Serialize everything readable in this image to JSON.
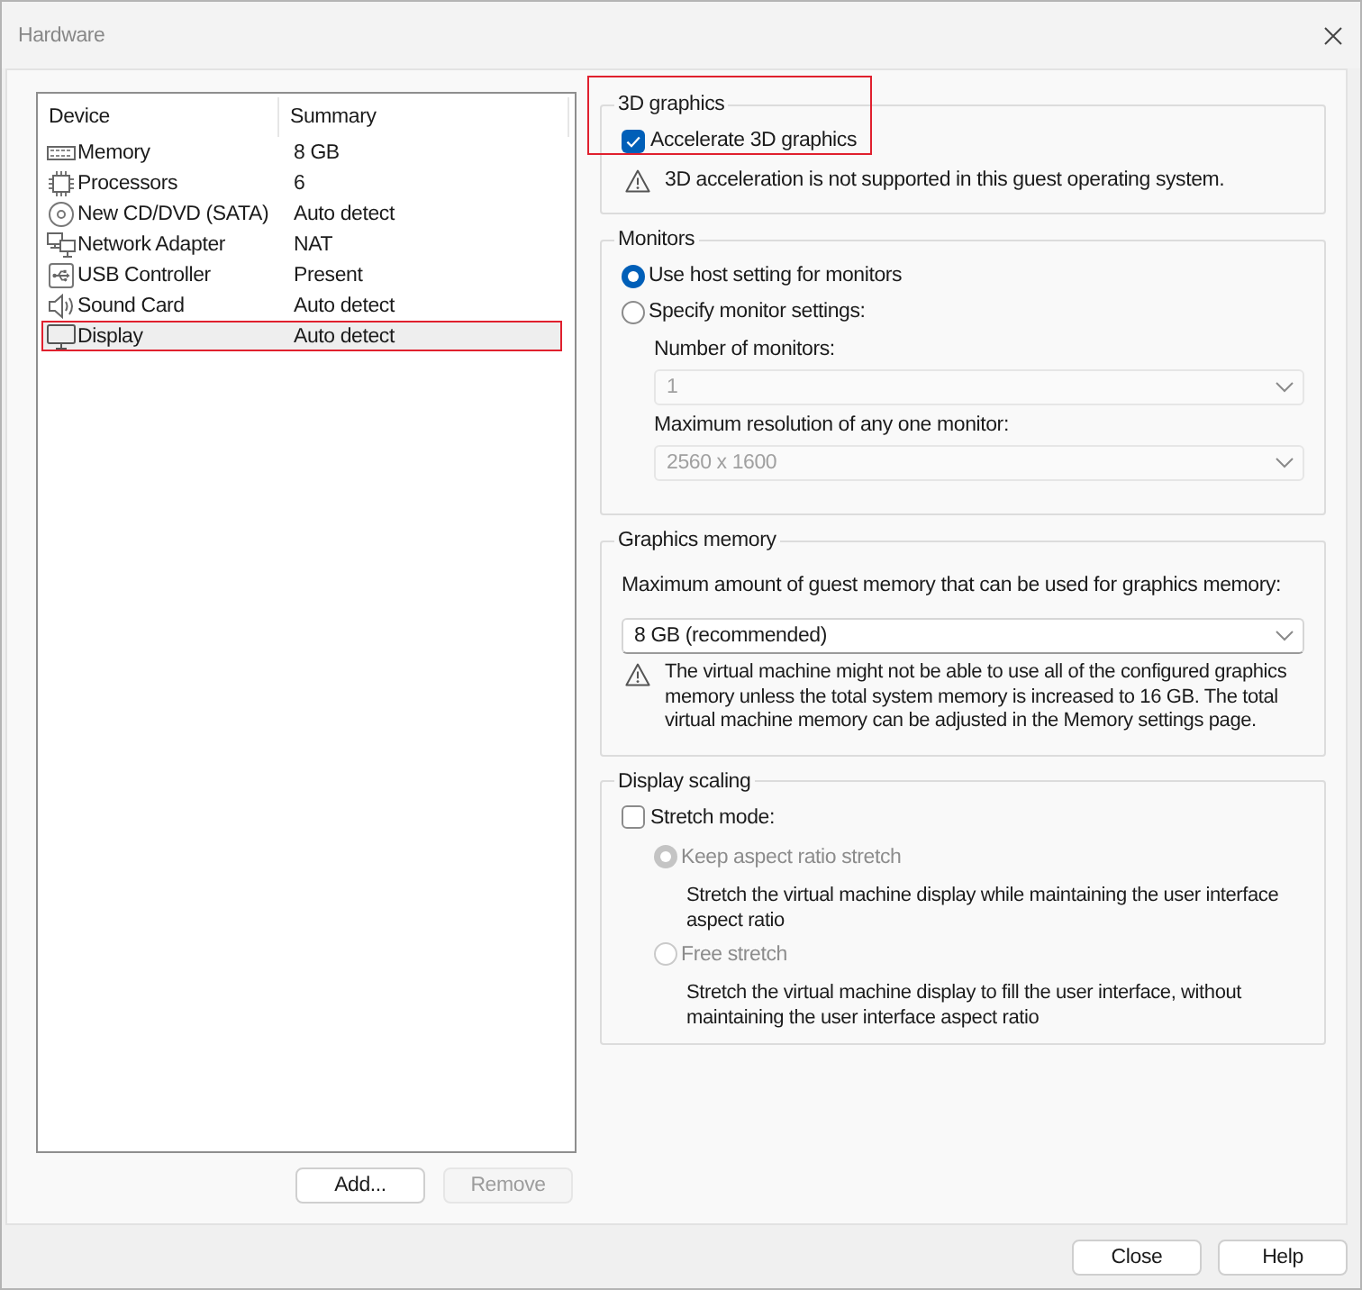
{
  "window": {
    "title": "Hardware"
  },
  "device_list": {
    "columns": [
      "Device",
      "Summary"
    ],
    "rows": [
      {
        "kind": "memory",
        "device": "Memory",
        "summary": "8 GB",
        "selected": false,
        "highlighted": false
      },
      {
        "kind": "processor",
        "device": "Processors",
        "summary": "6",
        "selected": false,
        "highlighted": false
      },
      {
        "kind": "disc",
        "device": "New CD/DVD (SATA)",
        "summary": "Auto detect",
        "selected": false,
        "highlighted": false
      },
      {
        "kind": "network",
        "device": "Network Adapter",
        "summary": "NAT",
        "selected": false,
        "highlighted": false
      },
      {
        "kind": "usb",
        "device": "USB Controller",
        "summary": "Present",
        "selected": false,
        "highlighted": false
      },
      {
        "kind": "sound",
        "device": "Sound Card",
        "summary": "Auto detect",
        "selected": false,
        "highlighted": false
      },
      {
        "kind": "display",
        "device": "Display",
        "summary": "Auto detect",
        "selected": true,
        "highlighted": true
      }
    ]
  },
  "list_buttons": [
    {
      "label": "Add...",
      "disabled": false
    },
    {
      "label": "Remove",
      "disabled": true
    }
  ],
  "graphics_3d": {
    "title": "3D graphics",
    "highlighted": true,
    "accelerate": {
      "label": "Accelerate 3D graphics",
      "checked": true
    },
    "warning": "3D acceleration is not supported in this guest operating system."
  },
  "monitors": {
    "title": "Monitors",
    "options": [
      {
        "label": "Use host setting for monitors",
        "selected": true
      },
      {
        "label": "Specify monitor settings:",
        "selected": false
      }
    ],
    "fields": [
      {
        "label": "Number of monitors:",
        "value": "1",
        "disabled": true
      },
      {
        "label": "Maximum resolution of any one monitor:",
        "value": "2560 x 1600",
        "disabled": true
      }
    ]
  },
  "graphics_memory": {
    "title": "Graphics memory",
    "label": "Maximum amount of guest memory that can be used for graphics memory:",
    "value": "8 GB (recommended)",
    "warning": "The virtual machine might not be able to use all of the configured graphics memory unless the total system memory is increased to 16 GB. The total virtual machine memory can be adjusted in the Memory settings page."
  },
  "display_scaling": {
    "title": "Display scaling",
    "stretch_mode": {
      "label": "Stretch mode:",
      "checked": false
    },
    "options": [
      {
        "label": "Keep aspect ratio stretch",
        "selected": true,
        "disabled": true,
        "description": "Stretch the virtual machine display while maintaining the user interface aspect ratio"
      },
      {
        "label": "Free stretch",
        "selected": false,
        "disabled": true,
        "description": "Stretch the virtual machine display to fill the user interface, without maintaining the user interface aspect ratio"
      }
    ]
  },
  "dialog_buttons": [
    {
      "label": "Close"
    },
    {
      "label": "Help"
    }
  ]
}
